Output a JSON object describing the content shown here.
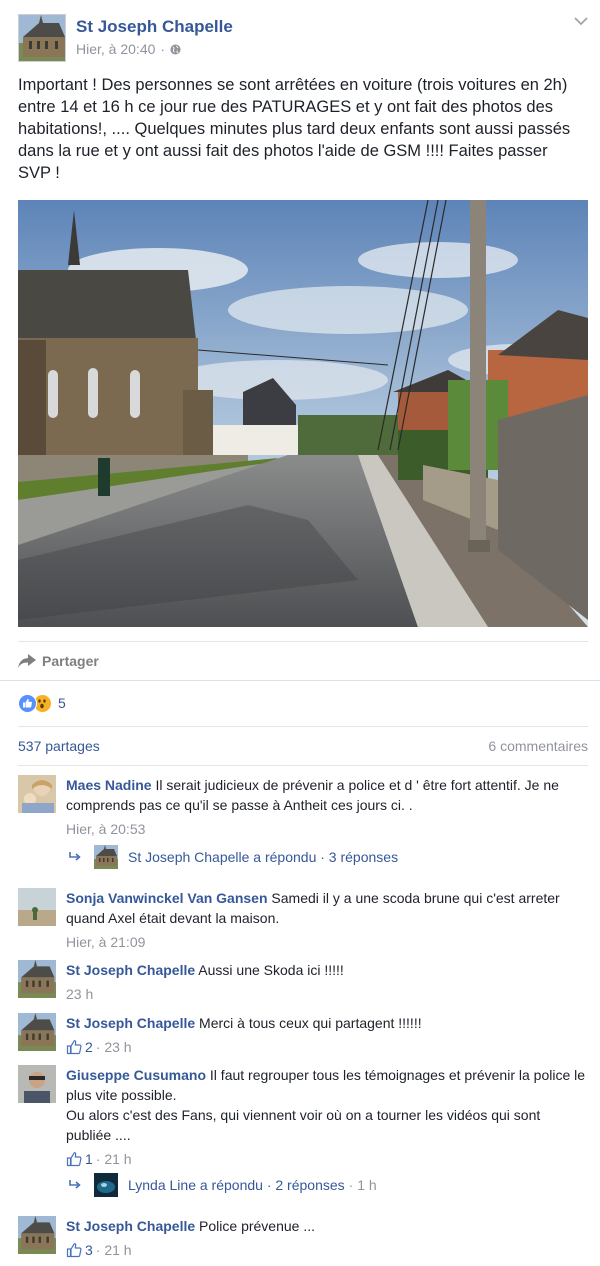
{
  "post": {
    "page_name": "St Joseph Chapelle",
    "timestamp": "Hier, à 20:40",
    "separator": "·",
    "text": "Important ! Des personnes se sont arrêtées en voiture (trois voitures en 2h) entre 14 et 16 h ce jour rue des PATURAGES et y ont fait des photos des habitations!, .... Quelques minutes plus tard deux enfants sont aussi passés dans la rue et y ont aussi fait des photos l'aide de GSM !!!! Faites passer SVP !"
  },
  "actions": {
    "share_label": "Partager"
  },
  "reactions": {
    "types": [
      "like",
      "wow"
    ],
    "count": "5"
  },
  "stats": {
    "shares": "537 partages",
    "comments": "6 commentaires"
  },
  "comments": [
    {
      "author": "Maes Nadine",
      "text": "Il serait judicieux de prévenir a police et d ' être fort attentif. Je ne comprends pas ce qu'il se passe à Antheit ces jours ci. .",
      "time": "Hier, à 20:53",
      "reply": {
        "author": "St Joseph Chapelle",
        "text": "St Joseph Chapelle a répondu · 3 réponses",
        "time": ""
      }
    },
    {
      "author": "Sonja Vanwinckel Van Gansen",
      "text": "Samedi il y a une scoda brune qui c'est arreter quand Axel était devant la maison.",
      "time": "Hier, à 21:09"
    },
    {
      "author": "St Joseph Chapelle",
      "text": "Aussi une Skoda ici !!!!!",
      "time": "23 h"
    },
    {
      "author": "St Joseph Chapelle",
      "text": "Merci à tous ceux qui partagent !!!!!!",
      "likes": "2",
      "time": "· 23 h"
    },
    {
      "author": "Giuseppe Cusumano",
      "text": "Il faut regrouper tous les témoignages et prévenir la police le plus vite possible.",
      "text2": "Ou alors c'est des Fans, qui viennent voir où on a tourner les vidéos qui sont publiée ....",
      "likes": "1",
      "time": "· 21 h",
      "reply": {
        "author": "Lynda Line",
        "text": "Lynda Line a répondu · 2 réponses",
        "time": "· 1 h"
      }
    },
    {
      "author": "St Joseph Chapelle",
      "text": "Police prévenue ...",
      "likes": "3",
      "time": "· 21 h"
    }
  ],
  "colors": {
    "link_blue": "#365899",
    "meta_grey": "#90949c",
    "like_blue": "#5890ff",
    "wow_yellow": "#f7b125"
  },
  "icons": [
    "globe-icon",
    "chevron-down-icon",
    "share-icon",
    "like-reaction-icon",
    "wow-reaction-icon",
    "thumb-icon",
    "reply-arrow-icon"
  ]
}
